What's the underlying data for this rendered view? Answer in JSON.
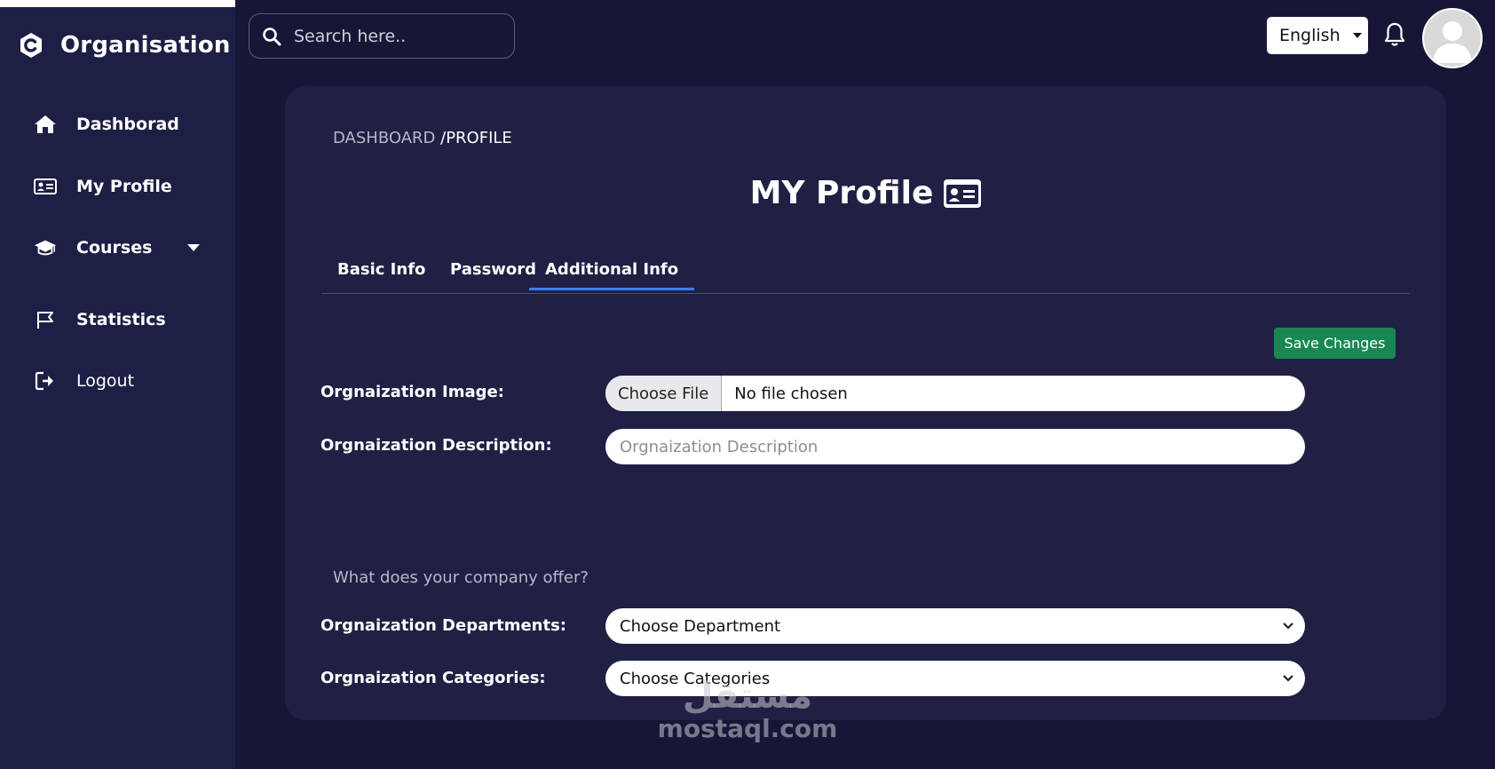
{
  "brand": {
    "name": "Organisation"
  },
  "sidebar": {
    "items": [
      {
        "label": "Dashborad"
      },
      {
        "label": "My Profile"
      },
      {
        "label": "Courses"
      },
      {
        "label": "Statistics"
      },
      {
        "label": "Logout"
      }
    ]
  },
  "header": {
    "search_placeholder": "Search here..",
    "language": "English"
  },
  "breadcrumb": {
    "part1": "DASHBOARD",
    "part2": "/PROFILE"
  },
  "page": {
    "title": "MY Profile"
  },
  "tabs": [
    {
      "label": "Basic Info"
    },
    {
      "label": "Password"
    },
    {
      "label": "Additional Info",
      "active": true
    }
  ],
  "form": {
    "save_label": "Save Changes",
    "image_label": "Orgnaization Image:",
    "file_button": "Choose File",
    "file_status": "No file chosen",
    "description_label": "Orgnaization Description:",
    "description_placeholder": "Orgnaization Description",
    "offer_question": "What does your company offer?",
    "departments_label": "Orgnaization Departments:",
    "departments_value": "Choose Department",
    "categories_label": "Orgnaization Categories:",
    "categories_value": "Choose Categories"
  },
  "watermark": {
    "arabic": "مستقل",
    "latin": "mostaql.com"
  },
  "colors": {
    "background": "#161737",
    "sidebar": "#1e1f45",
    "card": "#1f2044",
    "active_tab": "#3d7bfd",
    "save_button": "#198754"
  }
}
